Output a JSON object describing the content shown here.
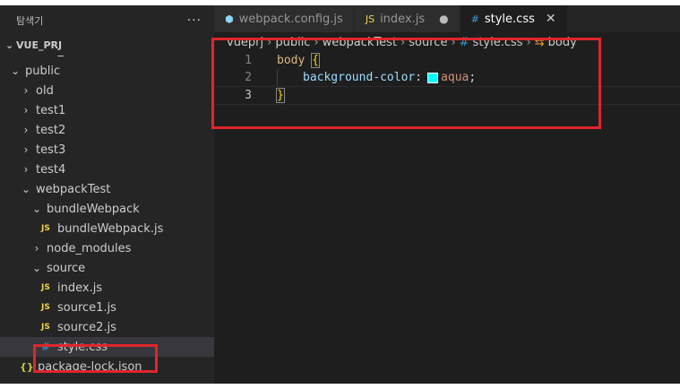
{
  "sidebar": {
    "title": "탐색기",
    "more": "···",
    "project": "VUE_PRJ",
    "clipped_item": "node_modules",
    "items": [
      {
        "label": "public",
        "kind": "folder-open",
        "depth": 1
      },
      {
        "label": "old",
        "kind": "folder",
        "depth": 2
      },
      {
        "label": "test1",
        "kind": "folder",
        "depth": 2
      },
      {
        "label": "test2",
        "kind": "folder",
        "depth": 2
      },
      {
        "label": "test3",
        "kind": "folder",
        "depth": 2
      },
      {
        "label": "test4",
        "kind": "folder",
        "depth": 2
      },
      {
        "label": "webpackTest",
        "kind": "folder-open",
        "depth": 2
      },
      {
        "label": "bundleWebpack",
        "kind": "folder-open",
        "depth": 3
      },
      {
        "label": "bundleWebpack.js",
        "kind": "js",
        "depth": 4
      },
      {
        "label": "node_modules",
        "kind": "folder",
        "depth": 3
      },
      {
        "label": "source",
        "kind": "folder-open",
        "depth": 3
      },
      {
        "label": "index.js",
        "kind": "js",
        "depth": 4
      },
      {
        "label": "source1.js",
        "kind": "js",
        "depth": 4
      },
      {
        "label": "source2.js",
        "kind": "js",
        "depth": 4
      },
      {
        "label": "style.css",
        "kind": "css",
        "depth": 4,
        "selected": true
      },
      {
        "label": "package-lock.json",
        "kind": "json",
        "depth": 2
      }
    ],
    "icons": {
      "js": "JS",
      "css": "#",
      "json": "{}",
      "folder": "›",
      "folder-open": "⌄"
    }
  },
  "tabs": [
    {
      "label": "webpack.config.js",
      "icon": "⬢",
      "icon_color": "#8ed6fb",
      "active": false
    },
    {
      "label": "index.js",
      "icon": "JS",
      "icon_color": "#f1d44c",
      "active": false,
      "modified_dot": "●"
    },
    {
      "label": "style.css",
      "icon": "#",
      "icon_color": "#3c9cd6",
      "active": true,
      "close": "✕"
    }
  ],
  "breadcrumb": {
    "segments": [
      "vueprj",
      "public",
      "webpackTest",
      "source",
      "style.css",
      "body"
    ],
    "separator": "›",
    "file_icon": "#",
    "symbol_icon": "⇆"
  },
  "code": {
    "line_numbers": [
      "1",
      "2",
      "3"
    ],
    "line1": {
      "selector": "body",
      "brace": "{"
    },
    "line2": {
      "property": "background-color",
      "colon": ":",
      "value": "aqua",
      "semicolon": ";"
    },
    "line3": {
      "brace": "}"
    }
  },
  "colors": {
    "accent_red": "#e0252b",
    "swatch": "#00ffff"
  }
}
